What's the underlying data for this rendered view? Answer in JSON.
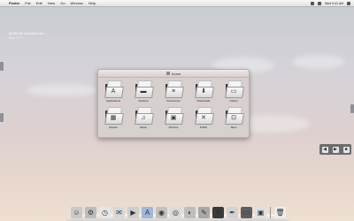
{
  "menubar": {
    "apple_glyph": "",
    "items": [
      "Finder",
      "File",
      "Edit",
      "View",
      "Go",
      "Window",
      "Help"
    ],
    "right_text": "Wed 9:41 AM"
  },
  "desktop_note": {
    "line1": "All We Are & Dreams Are",
    "line2": "Mac OS X"
  },
  "finder": {
    "title": "Home",
    "items": [
      {
        "label": "Applications",
        "glyph": "A"
      },
      {
        "label": "Desktop",
        "glyph": "▬"
      },
      {
        "label": "Documents",
        "glyph": "≡"
      },
      {
        "label": "Downloads",
        "glyph": "⬇"
      },
      {
        "label": "Library",
        "glyph": "▭"
      },
      {
        "label": "Movies",
        "glyph": "▦"
      },
      {
        "label": "Music",
        "glyph": "♫"
      },
      {
        "label": "Pictures",
        "glyph": "▣"
      },
      {
        "label": "Public",
        "glyph": "✕"
      },
      {
        "label": "Sites",
        "glyph": "⊡"
      }
    ]
  },
  "right_widget": {
    "buttons": [
      "◀",
      "▶",
      "■"
    ]
  },
  "dock": {
    "icons": [
      {
        "name": "finder-icon",
        "glyph": "☺",
        "color": "#c9c9c9"
      },
      {
        "name": "system-preferences-icon",
        "glyph": "⚙",
        "color": "#bcbcbc"
      },
      {
        "name": "clock-icon",
        "glyph": "◷",
        "color": "#e6e6e6"
      },
      {
        "name": "mail-icon",
        "glyph": "✉",
        "color": "#d8d8d8"
      },
      {
        "name": "media-icon",
        "glyph": "▶",
        "color": "#cfcfcf"
      },
      {
        "name": "app-store-icon",
        "glyph": "A",
        "color": "#9fb8d8"
      },
      {
        "name": "dashboard-icon",
        "glyph": "◉",
        "color": "#c2c2c2"
      },
      {
        "name": "camera-icon",
        "glyph": "◎",
        "color": "#dadada"
      },
      {
        "name": "dvd-player-icon",
        "glyph": "◐",
        "color": "#bdbdbd"
      },
      {
        "name": "tools-icon",
        "glyph": "✎",
        "color": "#a8a8a8"
      },
      {
        "name": "leaf-icon",
        "glyph": "❦",
        "color": "#3a3a3a"
      },
      {
        "name": "pen-icon",
        "glyph": "✒",
        "color": "#d2d2d2"
      },
      {
        "name": "terminal-icon",
        "glyph": "▭",
        "color": "#5e5e5e"
      },
      {
        "name": "photo-icon",
        "glyph": "▣",
        "color": "#e0e0e0"
      },
      {
        "name": "trash-icon",
        "glyph": "🗑",
        "color": "#ececec"
      }
    ]
  }
}
